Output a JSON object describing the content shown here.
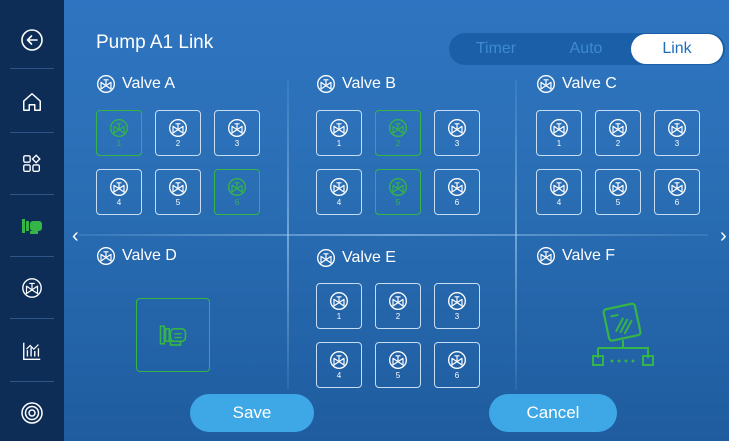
{
  "header": {
    "title": "Pump A1 Link",
    "mode_tabs": [
      {
        "label": "Timer",
        "active": false
      },
      {
        "label": "Auto",
        "active": false
      },
      {
        "label": "Link",
        "active": true
      }
    ]
  },
  "sidebar": {
    "items": [
      {
        "icon": "back-arrow-icon"
      },
      {
        "icon": "home-icon"
      },
      {
        "icon": "apps-grid-icon"
      },
      {
        "icon": "pump-icon",
        "active": true
      },
      {
        "icon": "valve-icon"
      },
      {
        "icon": "chart-icon"
      },
      {
        "icon": "settings-ring-icon"
      }
    ]
  },
  "sections": {
    "valve_a": {
      "title": "Valve A",
      "buttons": [
        {
          "label": "1",
          "on": true
        },
        {
          "label": "2",
          "on": false
        },
        {
          "label": "3",
          "on": false
        },
        {
          "label": "4",
          "on": false
        },
        {
          "label": "5",
          "on": false
        },
        {
          "label": "6",
          "on": true
        }
      ]
    },
    "valve_b": {
      "title": "Valve B",
      "buttons": [
        {
          "label": "1",
          "on": false
        },
        {
          "label": "2",
          "on": true
        },
        {
          "label": "3",
          "on": false
        },
        {
          "label": "4",
          "on": false
        },
        {
          "label": "5",
          "on": true
        },
        {
          "label": "6",
          "on": false
        }
      ]
    },
    "valve_c": {
      "title": "Valve C",
      "buttons": [
        {
          "label": "1",
          "on": false
        },
        {
          "label": "2",
          "on": false
        },
        {
          "label": "3",
          "on": false
        },
        {
          "label": "4",
          "on": false
        },
        {
          "label": "5",
          "on": false
        },
        {
          "label": "6",
          "on": false
        }
      ]
    },
    "valve_d": {
      "title": "Valve D"
    },
    "valve_e": {
      "title": "Valve E",
      "buttons": [
        {
          "label": "1",
          "on": false
        },
        {
          "label": "2",
          "on": false
        },
        {
          "label": "3",
          "on": false
        },
        {
          "label": "4",
          "on": false
        },
        {
          "label": "5",
          "on": false
        },
        {
          "label": "6",
          "on": false
        }
      ]
    },
    "valve_f": {
      "title": "Valve F"
    }
  },
  "actions": {
    "save_label": "Save",
    "cancel_label": "Cancel"
  },
  "colors": {
    "sidebar_bg": "#0d2c56",
    "main_bg": "#2b70b7",
    "active_green": "#35b547",
    "button_blue": "#3ea8e6"
  }
}
